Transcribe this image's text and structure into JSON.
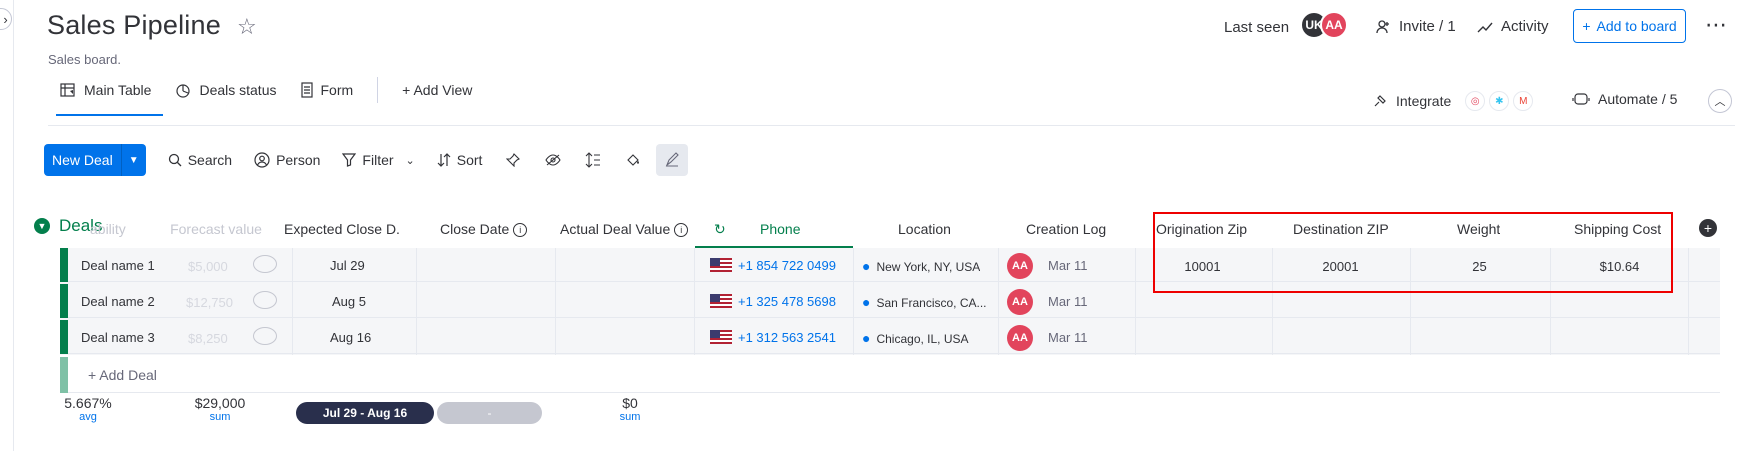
{
  "board": {
    "title": "Sales Pipeline",
    "description": "Sales board."
  },
  "header": {
    "last_seen_label": "Last seen",
    "avatars": [
      "UK",
      "AA"
    ],
    "invite_label": "Invite / 1",
    "activity_label": "Activity",
    "add_to_board_label": "Add to board"
  },
  "views": {
    "tabs": [
      {
        "label": "Main Table",
        "icon": "table-icon"
      },
      {
        "label": "Deals status",
        "icon": "chart-icon"
      },
      {
        "label": "Form",
        "icon": "form-icon"
      }
    ],
    "add_view_label": "+ Add View",
    "integrate_label": "Integrate",
    "automate_label": "Automate / 5"
  },
  "toolbar": {
    "new_item_label": "New Deal",
    "search_label": "Search",
    "person_label": "Person",
    "filter_label": "Filter",
    "sort_label": "Sort"
  },
  "group": {
    "name": "Deals",
    "color": "#037f4c"
  },
  "columns": {
    "prob_hidden": "ability",
    "forecast_hidden": "Forecast value",
    "expected_close": "Expected Close D...",
    "close_date": "Close Date",
    "actual_value": "Actual Deal Value",
    "phone": "Phone",
    "location": "Location",
    "creation_log": "Creation Log",
    "origination_zip": "Origination Zip",
    "destination_zip": "Destination ZIP",
    "weight": "Weight",
    "shipping_cost": "Shipping Cost"
  },
  "rows": [
    {
      "name": "Deal name 1",
      "forecast": "$5,000",
      "expected": "Jul 29",
      "phone": "+1 854 722 0499",
      "location": "New York, NY, USA",
      "creator": "AA",
      "created": "Mar 11",
      "orig_zip": "10001",
      "dest_zip": "20001",
      "weight": "25",
      "shipping": "$10.64"
    },
    {
      "name": "Deal name 2",
      "forecast": "$12,750",
      "expected": "Aug 5",
      "phone": "+1 325 478 5698",
      "location": "San Francisco, CA...",
      "creator": "AA",
      "created": "Mar 11",
      "orig_zip": "",
      "dest_zip": "",
      "weight": "",
      "shipping": ""
    },
    {
      "name": "Deal name 3",
      "forecast": "$8,250",
      "expected": "Aug 16",
      "phone": "+1 312 563 2541",
      "location": "Chicago, IL, USA",
      "creator": "AA",
      "created": "Mar 11",
      "orig_zip": "",
      "dest_zip": "",
      "weight": "",
      "shipping": ""
    }
  ],
  "add_item_label": "+ Add Deal",
  "summary": {
    "prob_value": "5.667%",
    "prob_label": "avg",
    "forecast_value": "$29,000",
    "forecast_label": "sum",
    "date_range": "Jul 29 - Aug 16",
    "close_empty": "-",
    "actual_value": "$0",
    "actual_label": "sum"
  }
}
